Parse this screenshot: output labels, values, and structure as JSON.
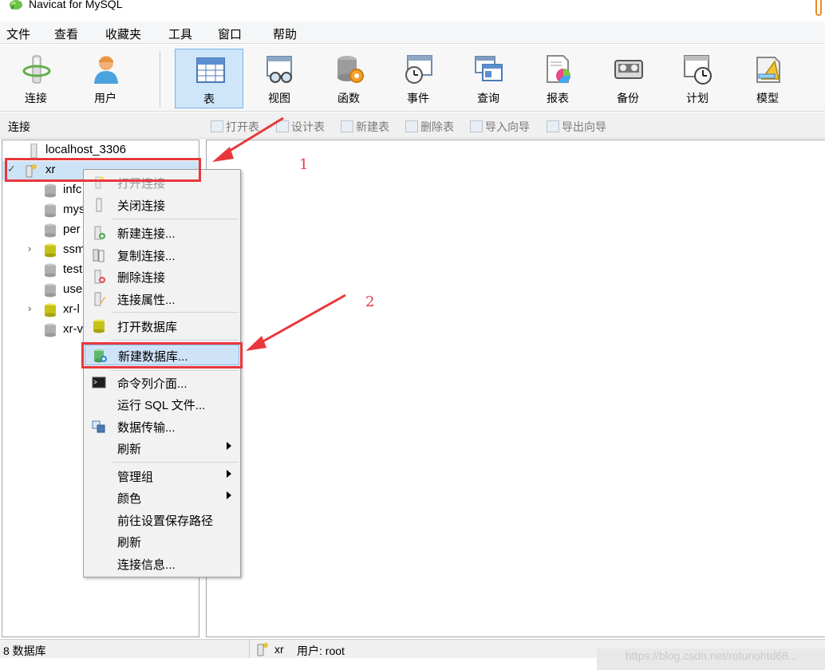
{
  "window": {
    "title": "Navicat for MySQL"
  },
  "menubar": {
    "items": [
      "文件",
      "查看",
      "收藏夹",
      "工具",
      "窗口",
      "帮助"
    ]
  },
  "toolbar": {
    "buttons": [
      {
        "label": "连接",
        "icon": "connection-plug-icon"
      },
      {
        "label": "用户",
        "icon": "user-icon"
      },
      {
        "label": "表",
        "icon": "table-icon",
        "active": true
      },
      {
        "label": "视图",
        "icon": "view-glasses-icon"
      },
      {
        "label": "函数",
        "icon": "function-db-gear-icon"
      },
      {
        "label": "事件",
        "icon": "event-clock-icon"
      },
      {
        "label": "查询",
        "icon": "query-windows-icon"
      },
      {
        "label": "报表",
        "icon": "report-piechart-icon"
      },
      {
        "label": "备份",
        "icon": "backup-tape-icon"
      },
      {
        "label": "计划",
        "icon": "schedule-calendar-clock-icon"
      },
      {
        "label": "模型",
        "icon": "model-ruler-icon"
      }
    ]
  },
  "subheader": {
    "title": "连接",
    "object_buttons": [
      "打开表",
      "设计表",
      "新建表",
      "删除表",
      "导入向导",
      "导出向导"
    ]
  },
  "tree": {
    "items": [
      {
        "label": "localhost_3306",
        "level": 0,
        "expandable": false,
        "icon": "connection-icon"
      },
      {
        "label": "xr",
        "level": 0,
        "expanded": true,
        "selected": true,
        "icon": "connection-open-icon"
      },
      {
        "label": "infc",
        "level": 1,
        "icon": "database-icon"
      },
      {
        "label": "mys",
        "level": 1,
        "icon": "database-icon"
      },
      {
        "label": "per",
        "level": 1,
        "icon": "database-icon"
      },
      {
        "label": "ssm",
        "level": 1,
        "expandable": true,
        "open": true,
        "icon": "database-open-icon"
      },
      {
        "label": "test",
        "level": 1,
        "icon": "database-icon"
      },
      {
        "label": "use",
        "level": 1,
        "icon": "database-icon"
      },
      {
        "label": "xr-l",
        "level": 1,
        "expandable": true,
        "open": true,
        "icon": "database-open-icon"
      },
      {
        "label": "xr-v",
        "level": 1,
        "icon": "database-icon"
      }
    ]
  },
  "context_menu": {
    "items": [
      {
        "label": "打开连接",
        "disabled": true,
        "icon": "open-connection-icon"
      },
      {
        "label": "关闭连接",
        "icon": "close-connection-icon"
      },
      {
        "sep": true
      },
      {
        "label": "新建连接...",
        "icon": "new-connection-icon"
      },
      {
        "label": "复制连接...",
        "icon": "copy-connection-icon"
      },
      {
        "label": "删除连接",
        "icon": "delete-connection-icon"
      },
      {
        "label": "连接属性...",
        "icon": "connection-properties-icon"
      },
      {
        "sep": true
      },
      {
        "label": "打开数据库",
        "icon": "open-database-icon"
      },
      {
        "sep": true
      },
      {
        "label": "新建数据库...",
        "highlight": true,
        "icon": "new-database-icon"
      },
      {
        "sep": true
      },
      {
        "label": "命令列介面...",
        "icon": "console-icon"
      },
      {
        "label": "运行 SQL 文件...",
        "icon": ""
      },
      {
        "label": "数据传输...",
        "icon": "data-transfer-icon"
      },
      {
        "label": "刷新",
        "submenu": true,
        "icon": ""
      },
      {
        "sep": true
      },
      {
        "label": "管理组",
        "submenu": true,
        "icon": ""
      },
      {
        "label": "颜色",
        "submenu": true,
        "icon": ""
      },
      {
        "label": "前往设置保存路径",
        "icon": ""
      },
      {
        "label": "刷新",
        "icon": ""
      },
      {
        "label": "连接信息...",
        "icon": ""
      }
    ]
  },
  "statusbar": {
    "left": "8 数据库",
    "connection": "xr",
    "user": "用户: root",
    "watermark": "https://blog.csdn.net/rotunohtd68..."
  },
  "annotations": {
    "step1": "1",
    "step2": "2",
    "color": "#e8383d"
  }
}
